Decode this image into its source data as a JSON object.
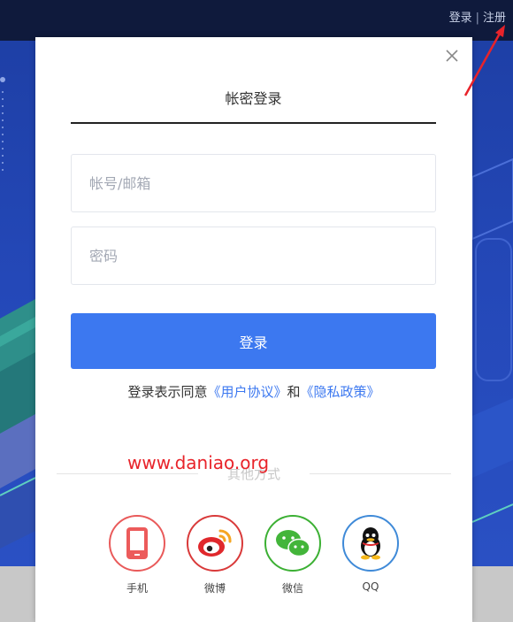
{
  "header": {
    "login_link": "登录",
    "separator": "|",
    "register_link": "注册"
  },
  "modal": {
    "tab_title": "帐密登录",
    "account_placeholder": "帐号/邮箱",
    "password_placeholder": "密码",
    "login_button": "登录",
    "agreement": {
      "prefix": "登录表示同意",
      "user_agreement": "《用户协议》",
      "and": "和",
      "privacy_policy": "《隐私政策》"
    },
    "other_methods_label": "其他方式",
    "watermark": "www.daniao.org",
    "social": [
      {
        "label": "手机",
        "icon": "phone-icon",
        "color": "#e95a5a"
      },
      {
        "label": "微博",
        "icon": "weibo-icon",
        "color": "#d93a3a"
      },
      {
        "label": "微信",
        "icon": "wechat-icon",
        "color": "#3cb034"
      },
      {
        "label": "QQ",
        "icon": "qq-icon",
        "color": "#3f8ad8"
      }
    ]
  },
  "colors": {
    "accent": "#3c78f0",
    "topbar": "#0f1a3c",
    "annotation_arrow": "#e8232a"
  }
}
